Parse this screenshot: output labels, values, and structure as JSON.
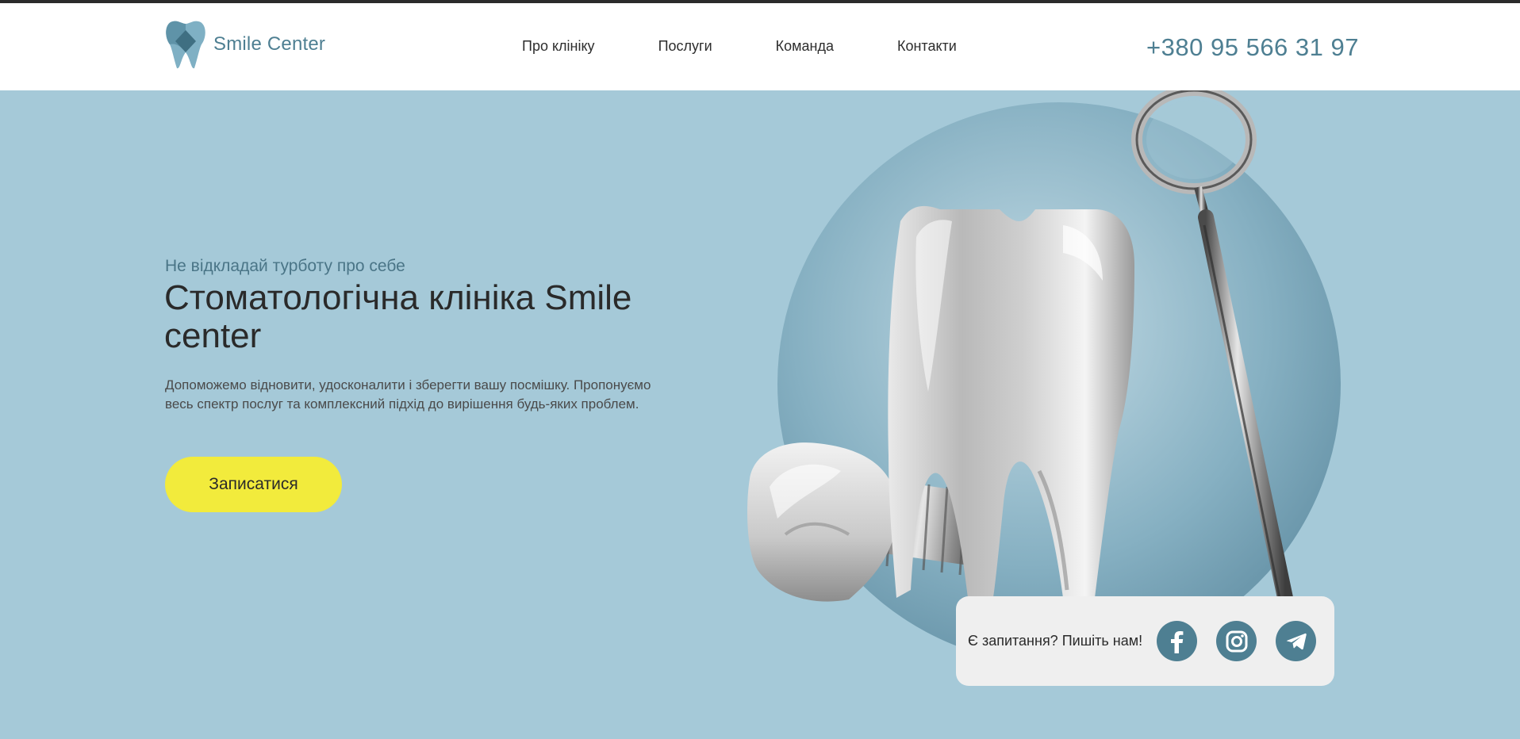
{
  "brand": {
    "name": "Smile Center",
    "logo_icon": "tooth-icon"
  },
  "nav": {
    "items": [
      {
        "label": "Про клініку"
      },
      {
        "label": "Послуги"
      },
      {
        "label": "Команда"
      },
      {
        "label": "Контакти"
      }
    ]
  },
  "header": {
    "phone": "+380 95 566 31 97"
  },
  "hero": {
    "eyebrow": "Не відкладай турботу про себе",
    "title": "Стоматологічна клініка Smile center",
    "description": "Допоможемо відновити, удосконалити і зберегти вашу посмішку. Пропонуємо весь спектр послуг та комплексний підхід до вирішення будь-яких проблем.",
    "cta_label": "Записатися",
    "illustration": "tooth-implant-dental-mirror-illustration"
  },
  "contact": {
    "text": "Є запитання? Пишіть нам!",
    "socials": [
      {
        "icon": "facebook-icon"
      },
      {
        "icon": "instagram-icon"
      },
      {
        "icon": "telegram-icon"
      }
    ]
  },
  "colors": {
    "accent": "#4e7f92",
    "hero_bg": "#a5c9d8",
    "cta_bg": "#f2eb3c",
    "circle": "#6f9db1",
    "card_bg": "#efefef"
  }
}
